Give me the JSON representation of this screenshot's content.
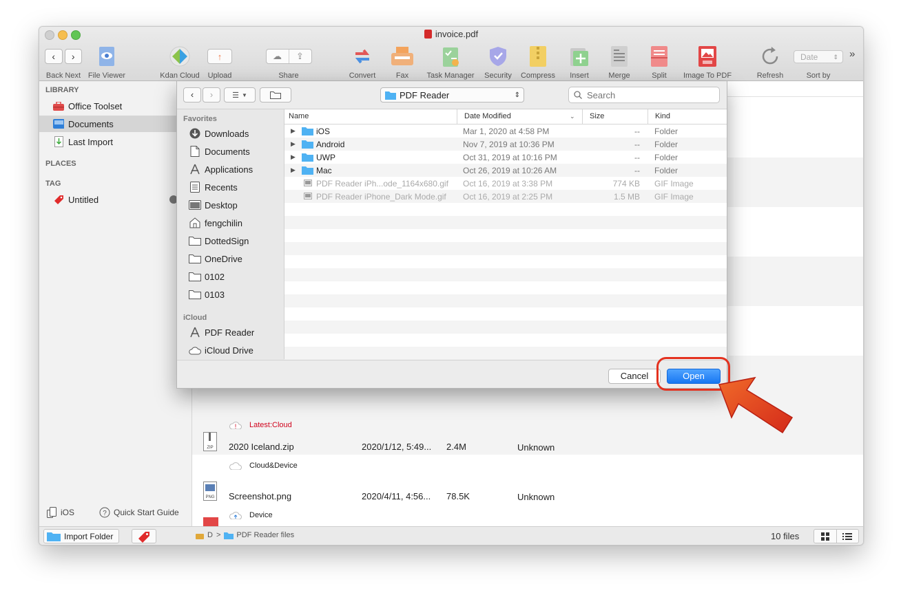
{
  "window": {
    "title": "invoice.pdf"
  },
  "toolbar": {
    "back_next_label": "Back Next",
    "file_viewer_label": "File Viewer",
    "kdan_cloud_label": "Kdan Cloud",
    "upload_label": "Upload",
    "share_label": "Share",
    "convert_label": "Convert",
    "fax_label": "Fax",
    "task_manager_label": "Task Manager",
    "security_label": "Security",
    "compress_label": "Compress",
    "insert_label": "Insert",
    "merge_label": "Merge",
    "split_label": "Split",
    "image_to_pdf_label": "Image To PDF",
    "refresh_label": "Refresh",
    "sort_by_label": "Sort by",
    "sort_value": "Date",
    "more_glyph": "»"
  },
  "sidebar": {
    "library_header": "LIBRARY",
    "items": [
      {
        "label": "Office Toolset"
      },
      {
        "label": "Documents"
      },
      {
        "label": "Last Import"
      }
    ],
    "places_header": "PLACES",
    "tag_header": "TAG",
    "tag_item": "Untitled",
    "ios_label": "iOS",
    "quick_start_label": "Quick Start Guide",
    "import_folder_label": "Import Folder"
  },
  "files": [
    {
      "name": "",
      "date": "",
      "size": "",
      "kind": "",
      "sync": "Latest:Cloud"
    },
    {
      "name": "2020 Iceland.zip",
      "date": "2020/1/12, 5:49...",
      "size": "2.4M",
      "kind": "Unknown",
      "sync": "Cloud&Device",
      "badge": "ZIP"
    },
    {
      "name": "Screenshot.png",
      "date": "2020/4/11, 4:56...",
      "size": "78.5K",
      "kind": "Unknown",
      "sync": "Device",
      "badge": "PNG"
    }
  ],
  "statusbar": {
    "path_drive": "D",
    "path_sep": ">",
    "path_folder": "PDF Reader files",
    "file_count": "10 files"
  },
  "dialog": {
    "location": "PDF Reader",
    "search_placeholder": "Search",
    "favorites_header": "Favorites",
    "favorites": [
      "Downloads",
      "Documents",
      "Applications",
      "Recents",
      "Desktop",
      "fengchilin",
      "DottedSign",
      "OneDrive",
      "0102",
      "0103"
    ],
    "icloud_header": "iCloud",
    "icloud_items": [
      "PDF Reader",
      "iCloud Drive"
    ],
    "columns": {
      "name": "Name",
      "date": "Date Modified",
      "size": "Size",
      "kind": "Kind"
    },
    "rows": [
      {
        "name": "iOS",
        "date": "Mar 1, 2020 at 4:58 PM",
        "size": "--",
        "kind": "Folder",
        "type": "folder"
      },
      {
        "name": "Android",
        "date": "Nov 7, 2019 at 10:36 PM",
        "size": "--",
        "kind": "Folder",
        "type": "folder"
      },
      {
        "name": "UWP",
        "date": "Oct 31, 2019 at 10:16 PM",
        "size": "--",
        "kind": "Folder",
        "type": "folder"
      },
      {
        "name": "Mac",
        "date": "Oct 26, 2019 at 10:26 AM",
        "size": "--",
        "kind": "Folder",
        "type": "folder"
      },
      {
        "name": "PDF Reader iPh...ode_1164x680.gif",
        "date": "Oct 16, 2019 at 3:38 PM",
        "size": "774 KB",
        "kind": "GIF Image",
        "type": "gif"
      },
      {
        "name": "PDF Reader iPhone_Dark Mode.gif",
        "date": "Oct 16, 2019 at 2:25 PM",
        "size": "1.5 MB",
        "kind": "GIF Image",
        "type": "gif"
      }
    ],
    "cancel_label": "Cancel",
    "open_label": "Open"
  },
  "colors": {
    "accent": "#1877f2",
    "highlight": "#e4321f",
    "sync_warning": "#d0021b",
    "folder": "#4fb2f3"
  }
}
